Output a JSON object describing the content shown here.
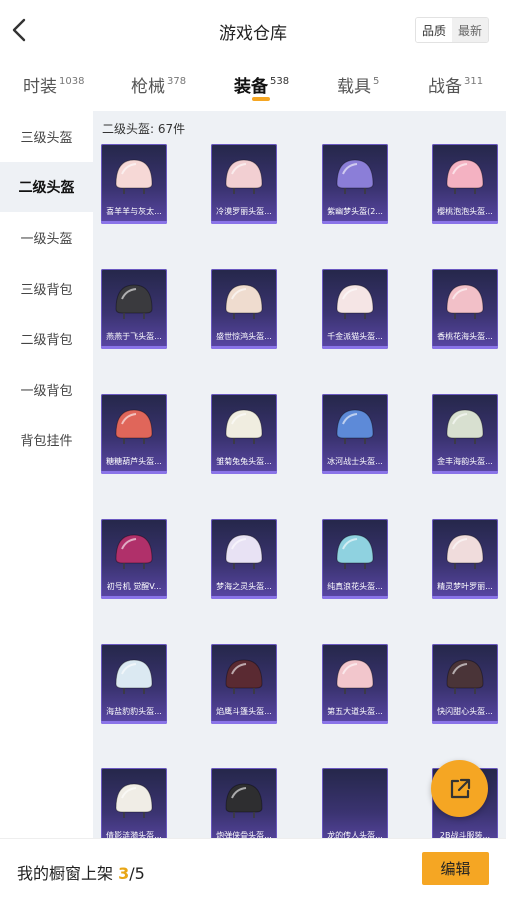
{
  "header": {
    "title": "游戏仓库",
    "sort_options": [
      "品质",
      "最新"
    ],
    "sort_selected": "最新"
  },
  "tabs": [
    {
      "label": "时装",
      "count": "1038"
    },
    {
      "label": "枪械",
      "count": "378"
    },
    {
      "label": "装备",
      "count": "538"
    },
    {
      "label": "载具",
      "count": "5"
    },
    {
      "label": "战备",
      "count": "311"
    }
  ],
  "active_tab": "装备",
  "sidebar": {
    "items": [
      "三级头盔",
      "二级头盔",
      "一级头盔",
      "三级背包",
      "二级背包",
      "一级背包",
      "背包挂件"
    ],
    "active": "二级头盔"
  },
  "content": {
    "count_label": "二级头盔: 67件",
    "items": [
      {
        "name": "喜羊羊与灰太...",
        "color": "#f6d8d6"
      },
      {
        "name": "冷漠罗丽头盔...",
        "color": "#f2cfd2"
      },
      {
        "name": "紫幽梦头盔(2...",
        "color": "#8b7ed8"
      },
      {
        "name": "樱桃泡泡头盔...",
        "color": "#f4b2c2"
      },
      {
        "name": "燕燕于飞头盔...",
        "color": "#3a3a3e"
      },
      {
        "name": "盛世惊鸿头盔...",
        "color": "#efdccf"
      },
      {
        "name": "千金派猫头盔...",
        "color": "#f5e5e5"
      },
      {
        "name": "香桃花海头盔...",
        "color": "#f2c0c8"
      },
      {
        "name": "糖糖葫芦头盔...",
        "color": "#e0665a"
      },
      {
        "name": "雏菊兔兔头盔...",
        "color": "#f0ede0"
      },
      {
        "name": "冰河战士头盔...",
        "color": "#5d8ad8"
      },
      {
        "name": "金丰海韵头盔...",
        "color": "#d8e0d0"
      },
      {
        "name": "初号机 觉醒V...",
        "color": "#b0306a"
      },
      {
        "name": "梦海之灵头盔...",
        "color": "#e8e2f4"
      },
      {
        "name": "纯真浪花头盔...",
        "color": "#8fd2e0"
      },
      {
        "name": "精灵梦叶罗丽...",
        "color": "#f0dcdc"
      },
      {
        "name": "海盐豹豹头盔...",
        "color": "#dbe9f2"
      },
      {
        "name": "焰鹰斗篷头盔...",
        "color": "#5a2a32"
      },
      {
        "name": "第五大道头盔...",
        "color": "#f2c6cc"
      },
      {
        "name": "快闪甜心头盔...",
        "color": "#4a3438"
      },
      {
        "name": "倩影涟漪头盔...",
        "color": "#f0ede6"
      },
      {
        "name": "炮弹侠骨头盔...",
        "color": "#2e2e30"
      },
      {
        "name": "龙的传人头盔...",
        "color": ""
      },
      {
        "name": "2B战斗服装...",
        "color": ""
      }
    ]
  },
  "footer": {
    "shelf_prefix": "我的橱窗上架 ",
    "shelf_current": "3",
    "shelf_total": "/5",
    "edit_label": "编辑"
  },
  "colors": {
    "accent": "#f5a623",
    "card_bg": "#3a3370"
  },
  "icons": {
    "back": "chevron-left-icon",
    "fab": "share-external-icon"
  }
}
